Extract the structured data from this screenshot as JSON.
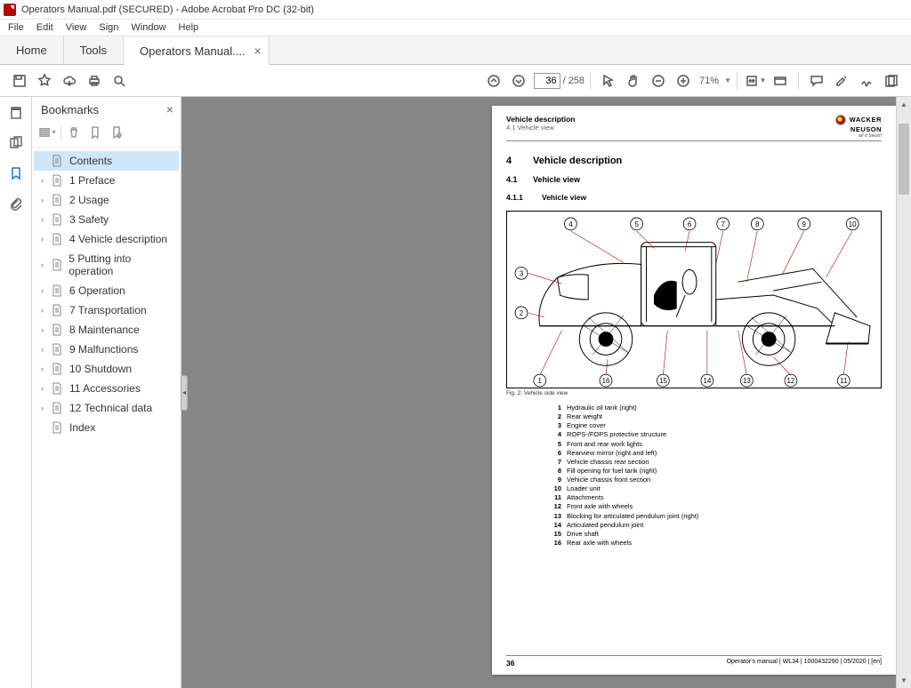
{
  "window": {
    "title": "Operators Manual.pdf (SECURED) - Adobe Acrobat Pro DC (32-bit)"
  },
  "menu": [
    "File",
    "Edit",
    "View",
    "Sign",
    "Window",
    "Help"
  ],
  "tabs": {
    "home": "Home",
    "tools": "Tools",
    "doc": "Operators Manual...."
  },
  "toolbar": {
    "page_current": "36",
    "page_total": "/ 258",
    "zoom": "71%"
  },
  "bookmarks": {
    "title": "Bookmarks",
    "items": [
      {
        "label": "Contents",
        "expandable": false,
        "selected": true
      },
      {
        "label": "1 Preface",
        "expandable": true
      },
      {
        "label": "2 Usage",
        "expandable": true
      },
      {
        "label": "3 Safety",
        "expandable": true
      },
      {
        "label": "4 Vehicle description",
        "expandable": true
      },
      {
        "label": "5 Putting into operation",
        "expandable": true
      },
      {
        "label": "6 Operation",
        "expandable": true
      },
      {
        "label": "7 Transportation",
        "expandable": true
      },
      {
        "label": "8 Maintenance",
        "expandable": true
      },
      {
        "label": "9 Malfunctions",
        "expandable": true
      },
      {
        "label": "10 Shutdown",
        "expandable": true
      },
      {
        "label": "11 Accessories",
        "expandable": true
      },
      {
        "label": "12 Technical data",
        "expandable": true
      },
      {
        "label": "Index",
        "expandable": false
      }
    ]
  },
  "page": {
    "header": {
      "title": "Vehicle description",
      "sub": "4.1 Vehicle view"
    },
    "brand": {
      "line1": "WACKER",
      "line2": "NEUSON",
      "tag": "all it takes!"
    },
    "h4_num": "4",
    "h4": "Vehicle description",
    "h41_num": "4.1",
    "h41": "Vehicle view",
    "h411_num": "4.1.1",
    "h411": "Vehicle view",
    "figcap": "Fig. 2: Vehicle side view",
    "callouts_top": [
      "4",
      "5",
      "6",
      "7",
      "8",
      "9",
      "10"
    ],
    "callouts_left": [
      "3",
      "2"
    ],
    "callouts_bottom": [
      "1",
      "16",
      "15",
      "14",
      "13",
      "12",
      "11"
    ],
    "parts": [
      {
        "n": "1",
        "t": "Hydraulic oil tank (right)"
      },
      {
        "n": "2",
        "t": "Rear weight"
      },
      {
        "n": "3",
        "t": "Engine cover"
      },
      {
        "n": "4",
        "t": "ROPS-/FOPS protective structure"
      },
      {
        "n": "5",
        "t": "Front and rear work lights"
      },
      {
        "n": "6",
        "t": "Rearview mirror (right and left)"
      },
      {
        "n": "7",
        "t": "Vehicle chassis rear section"
      },
      {
        "n": "8",
        "t": "Fill opening for fuel tank (right)"
      },
      {
        "n": "9",
        "t": "Vehicle chassis front section"
      },
      {
        "n": "10",
        "t": "Loader unit"
      },
      {
        "n": "11",
        "t": "Attachments"
      },
      {
        "n": "12",
        "t": "Front axle with wheels"
      },
      {
        "n": "13",
        "t": "Blocking for articulated pendulum joint (right)"
      },
      {
        "n": "14",
        "t": "Articulated pendulum joint"
      },
      {
        "n": "15",
        "t": "Drive shaft"
      },
      {
        "n": "16",
        "t": "Rear axle with wheels"
      }
    ],
    "footer": {
      "page": "36",
      "right": "Operator's manual | WL34 | 1000432290 | 05/2020 | [en]"
    }
  }
}
